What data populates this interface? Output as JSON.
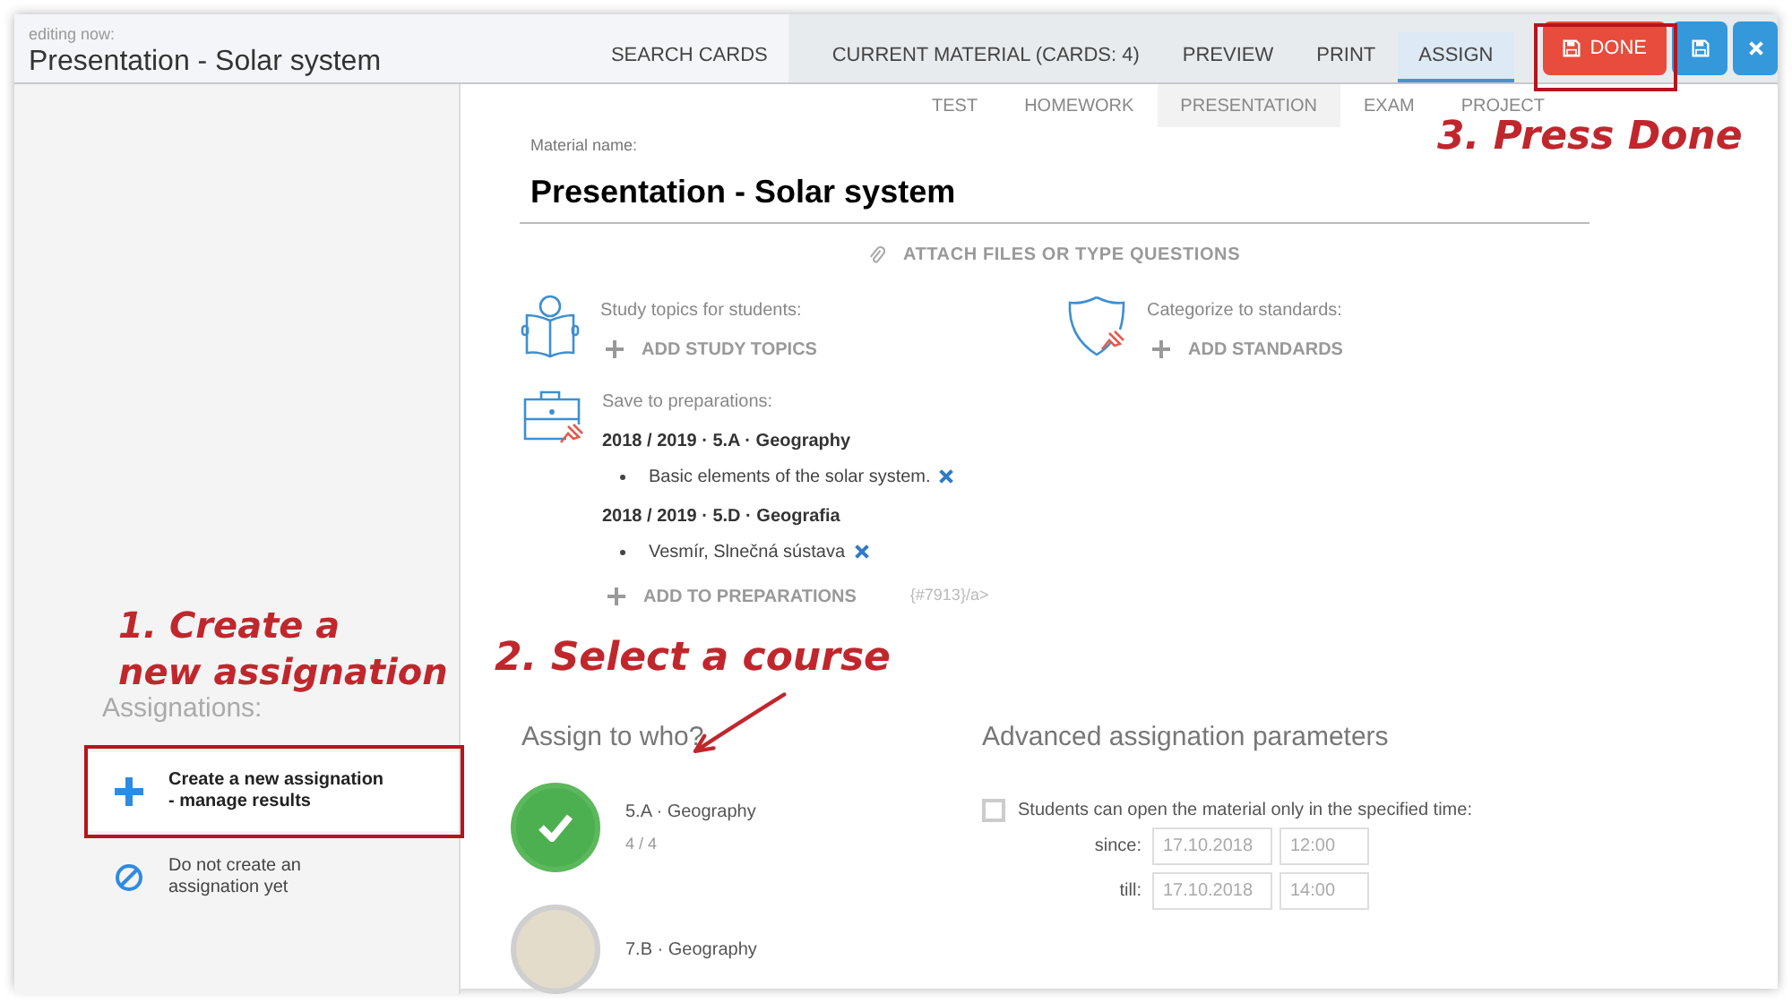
{
  "header": {
    "caption": "editing now:",
    "title": "Presentation - Solar system"
  },
  "nav_tabs": [
    {
      "label": "SEARCH CARDS",
      "selected": false,
      "kind": "plain"
    },
    {
      "label": "CURRENT MATERIAL (CARDS: 4)",
      "selected": false,
      "kind": "grouped"
    },
    {
      "label": "PREVIEW",
      "selected": false,
      "kind": "grouped"
    },
    {
      "label": "PRINT",
      "selected": false,
      "kind": "grouped"
    },
    {
      "label": "ASSIGN",
      "selected": true,
      "kind": "grouped"
    }
  ],
  "actions": [
    {
      "kind": "done",
      "label": "DONE"
    },
    {
      "kind": "save"
    },
    {
      "kind": "close"
    }
  ],
  "material_types": [
    {
      "label": "TEST",
      "selected": false
    },
    {
      "label": "HOMEWORK",
      "selected": false
    },
    {
      "label": "PRESENTATION",
      "selected": true
    },
    {
      "label": "EXAM",
      "selected": false
    },
    {
      "label": "PROJECT",
      "selected": false
    }
  ],
  "material_name": {
    "label": "Material name:",
    "value": "Presentation - Solar system"
  },
  "attach": "ATTACH FILES OR TYPE QUESTIONS",
  "study_topics": {
    "label": "Study topics for students:",
    "action": "ADD STUDY TOPICS"
  },
  "standards": {
    "label": "Categorize to standards:",
    "action": "ADD STANDARDS"
  },
  "preparations": {
    "label": "Save to preparations:",
    "groups": [
      {
        "title": "2018 / 2019 · 5.A · Geography",
        "items": [
          "Basic elements of the solar system."
        ]
      },
      {
        "title": "2018 / 2019 · 5.D · Geografia",
        "items": [
          "Vesmír, Slnečná sústava"
        ]
      }
    ],
    "action": "ADD TO PREPARATIONS",
    "note": "{#7913}/a>"
  },
  "assignations": {
    "heading": "Assignations:",
    "options": [
      {
        "kind": "create",
        "text": "Create a new assignation\n- manage results",
        "selected": true
      },
      {
        "kind": "none",
        "text": "Do not create an\nassignation yet",
        "selected": false
      }
    ]
  },
  "assign_to": {
    "heading": "Assign to who?",
    "courses": [
      {
        "name": "5.A · Geography",
        "count": "4 / 4",
        "selected": true
      },
      {
        "name": "7.B · Geography",
        "selected": false
      }
    ]
  },
  "advanced": {
    "heading": "Advanced assignation parameters",
    "restrict": {
      "label": "Students can open the material only in the specified time:",
      "checked": false
    },
    "rows": [
      {
        "label": "since:",
        "date": "17.10.2018",
        "time": "12:00"
      },
      {
        "label": "till:",
        "date": "17.10.2018",
        "time": "14:00"
      }
    ]
  },
  "annotations": [
    {
      "kind": "create",
      "text": "1. Create a\nnew assignation"
    },
    {
      "kind": "course",
      "text": "2. Select a course"
    },
    {
      "kind": "done",
      "text": "3. Press Done"
    }
  ]
}
